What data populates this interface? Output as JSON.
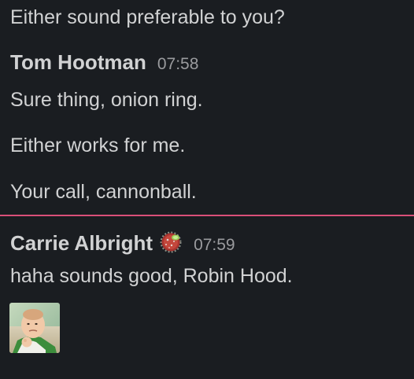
{
  "messages": {
    "prev_line": "Either sound preferable to you?",
    "tom": {
      "author": "Tom Hootman",
      "time": "07:58",
      "lines": [
        "Sure thing, onion ring.",
        "Either works for me.",
        "Your call, cannonball."
      ]
    },
    "carrie": {
      "author": "Carrie Albright",
      "time": "07:59",
      "status_icon": "virus-emoji-icon",
      "lines": [
        "haha sounds good, Robin Hood."
      ],
      "attachment_icon": "baby-image-thumbnail"
    }
  },
  "colors": {
    "background": "#1a1d21",
    "text": "#d1d2d3",
    "timestamp": "#9a9b9e",
    "new_message_divider": "#d94f79"
  }
}
